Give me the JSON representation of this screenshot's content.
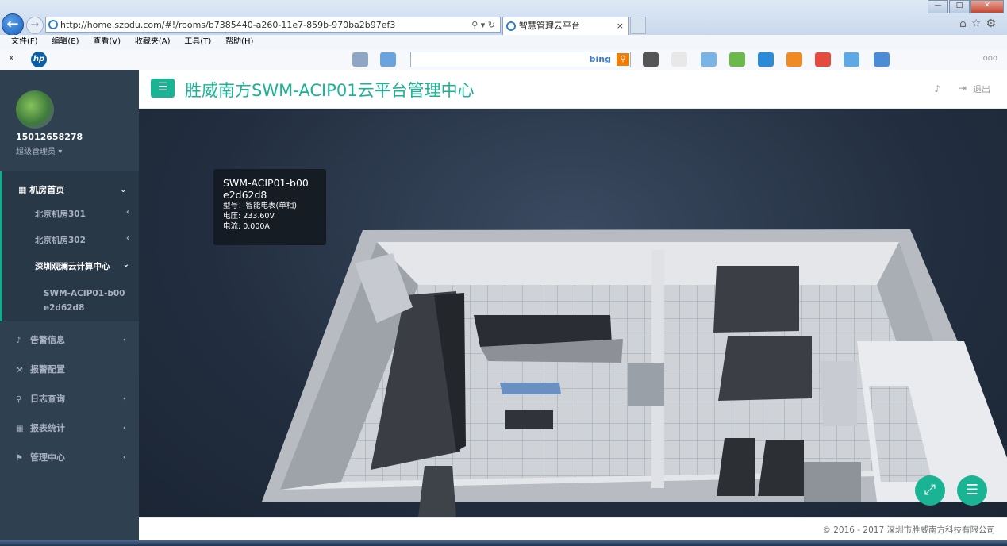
{
  "browser": {
    "url": "http://home.szpdu.com/#!/rooms/b7385440-a260-11e7-859b-970ba2b97ef3",
    "tab_title": "智慧管理云平台",
    "tab_close": "×",
    "menu": [
      "文件(F)",
      "编辑(E)",
      "查看(V)",
      "收藏夹(A)",
      "工具(T)",
      "帮助(H)"
    ],
    "search_brand": "bing",
    "fav_close": "x",
    "overflow": "ooo"
  },
  "sidebar": {
    "username": "15012658278",
    "role": "超级管理员",
    "active_section": "机房首页",
    "rooms": [
      "北京机房301",
      "北京机房302",
      "深圳观澜云计算中心"
    ],
    "device": "SWM-ACIP01-b00e2d62d8",
    "items": [
      "告警信息",
      "报警配置",
      "日志查询",
      "报表统计",
      "管理中心"
    ]
  },
  "header": {
    "title": "胜威南方SWM-ACIP01云平台管理中心",
    "logout": "退出"
  },
  "tooltip": {
    "title": "SWM-ACIP01-b00e2d62d8",
    "model": "型号：智能电表(单相)",
    "voltage": "电压: 233.60V",
    "current": "电流: 0.000A"
  },
  "footer": {
    "copyright": "© 2016 - 2017 深圳市胜威南方科技有限公司"
  },
  "colors": {
    "accent": "#1ab394",
    "sidebar_bg": "#2f4050",
    "scene_bg": "#2a3649"
  }
}
